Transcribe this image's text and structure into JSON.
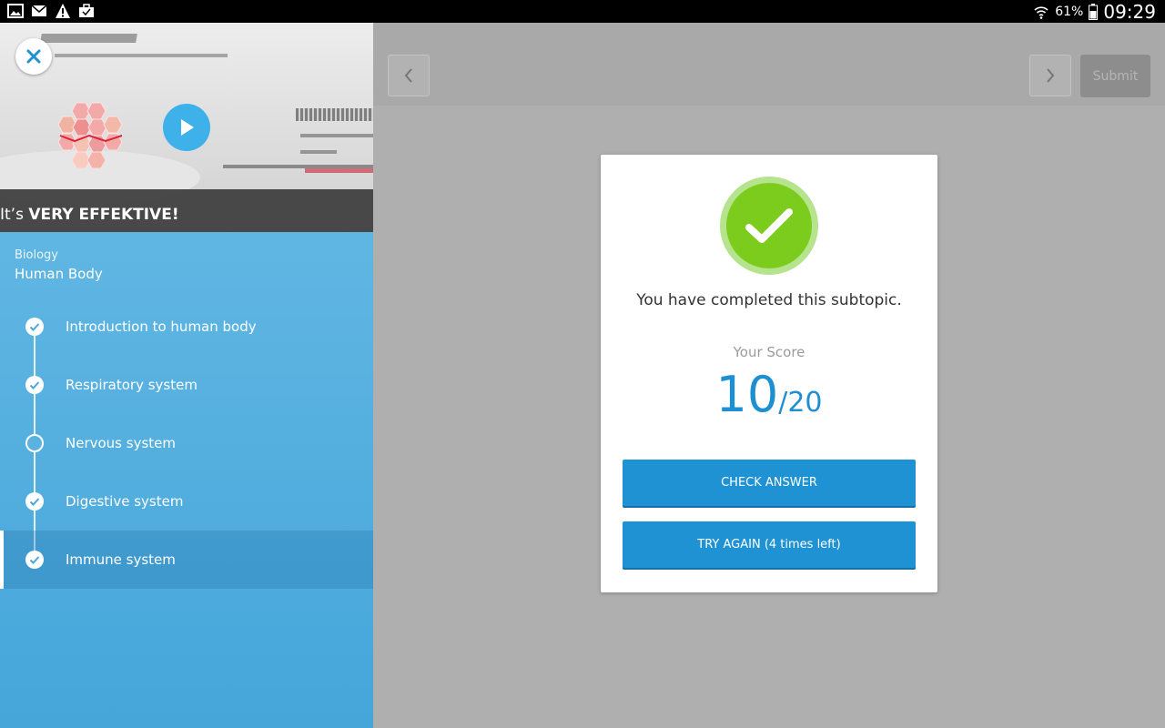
{
  "status_bar": {
    "notification_icons": [
      "gallery-icon",
      "mail-icon",
      "warning-icon",
      "briefcase-icon"
    ],
    "battery_percent": "61%",
    "clock": "09:29"
  },
  "video": {
    "caption_prefix": "It’s ",
    "caption_emphasis": "VERY EFFEKTIVE!"
  },
  "course": {
    "subject": "Biology",
    "topic": "Human Body",
    "subtopics": [
      {
        "label": "Introduction to human body",
        "status": "done"
      },
      {
        "label": "Respiratory system",
        "status": "done"
      },
      {
        "label": "Nervous system",
        "status": "todo"
      },
      {
        "label": "Digestive system",
        "status": "done"
      },
      {
        "label": "Immune system",
        "status": "done",
        "active": true
      }
    ]
  },
  "toolbar": {
    "submit_label": "Submit"
  },
  "result": {
    "message": "You have completed this subtopic.",
    "score_label": "Your Score",
    "score": "10",
    "score_separator": "/",
    "total": "20",
    "check_answer_label": "CHECK ANSWER",
    "try_again_label": "TRY AGAIN (4 times left)"
  },
  "colors": {
    "accent": "#1e92d3",
    "success": "#7ccc1e",
    "panel": "#45a6da"
  }
}
